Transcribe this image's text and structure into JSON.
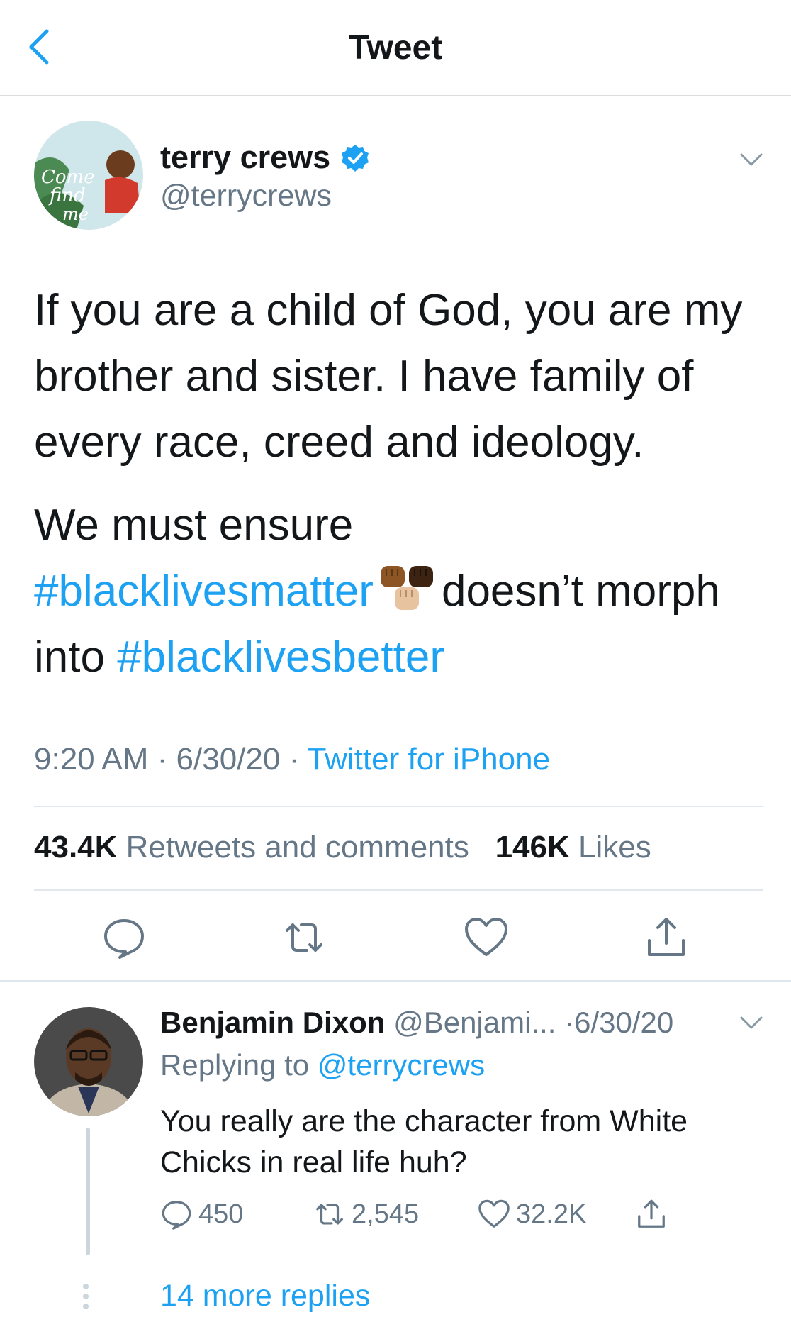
{
  "header": {
    "title": "Tweet"
  },
  "tweet": {
    "author_name": "terry crews",
    "author_handle": "@terrycrews",
    "line1": "If you are a child of God, you are my",
    "line2": "brother and sister. I have family of",
    "line3": "every race, creed and ideology.",
    "line4": "We must ensure",
    "hashtag1": "#blacklivesmatter",
    "line5_rest": "doesn’t morph",
    "line6_pre": "into ",
    "hashtag2": "#blacklivesbetter",
    "time": "9:20 AM",
    "date": "6/30/20",
    "source": "Twitter for iPhone",
    "separator": " · ",
    "retweets_count": "43.4K",
    "retweets_label": "Retweets and comments",
    "likes_count": "146K",
    "likes_label": "Likes"
  },
  "reply": {
    "author_name": "Benjamin Dixon",
    "author_handle": "@Benjami...",
    "date": "·6/30/20",
    "replying_prefix": "Replying to ",
    "replying_to": "@terrycrews",
    "text": "You really are the character from White Chicks in real life huh?",
    "replies": "450",
    "retweets": "2,545",
    "likes": "32.2K"
  },
  "more_replies": "14 more replies",
  "colors": {
    "accent": "#1da1f2",
    "muted": "#657786",
    "text": "#14171a"
  },
  "icons": [
    "back-chevron-icon",
    "verified-badge-icon",
    "chevron-down-icon",
    "reply-icon",
    "retweet-icon",
    "heart-icon",
    "share-icon",
    "fist-emoji-icon"
  ]
}
